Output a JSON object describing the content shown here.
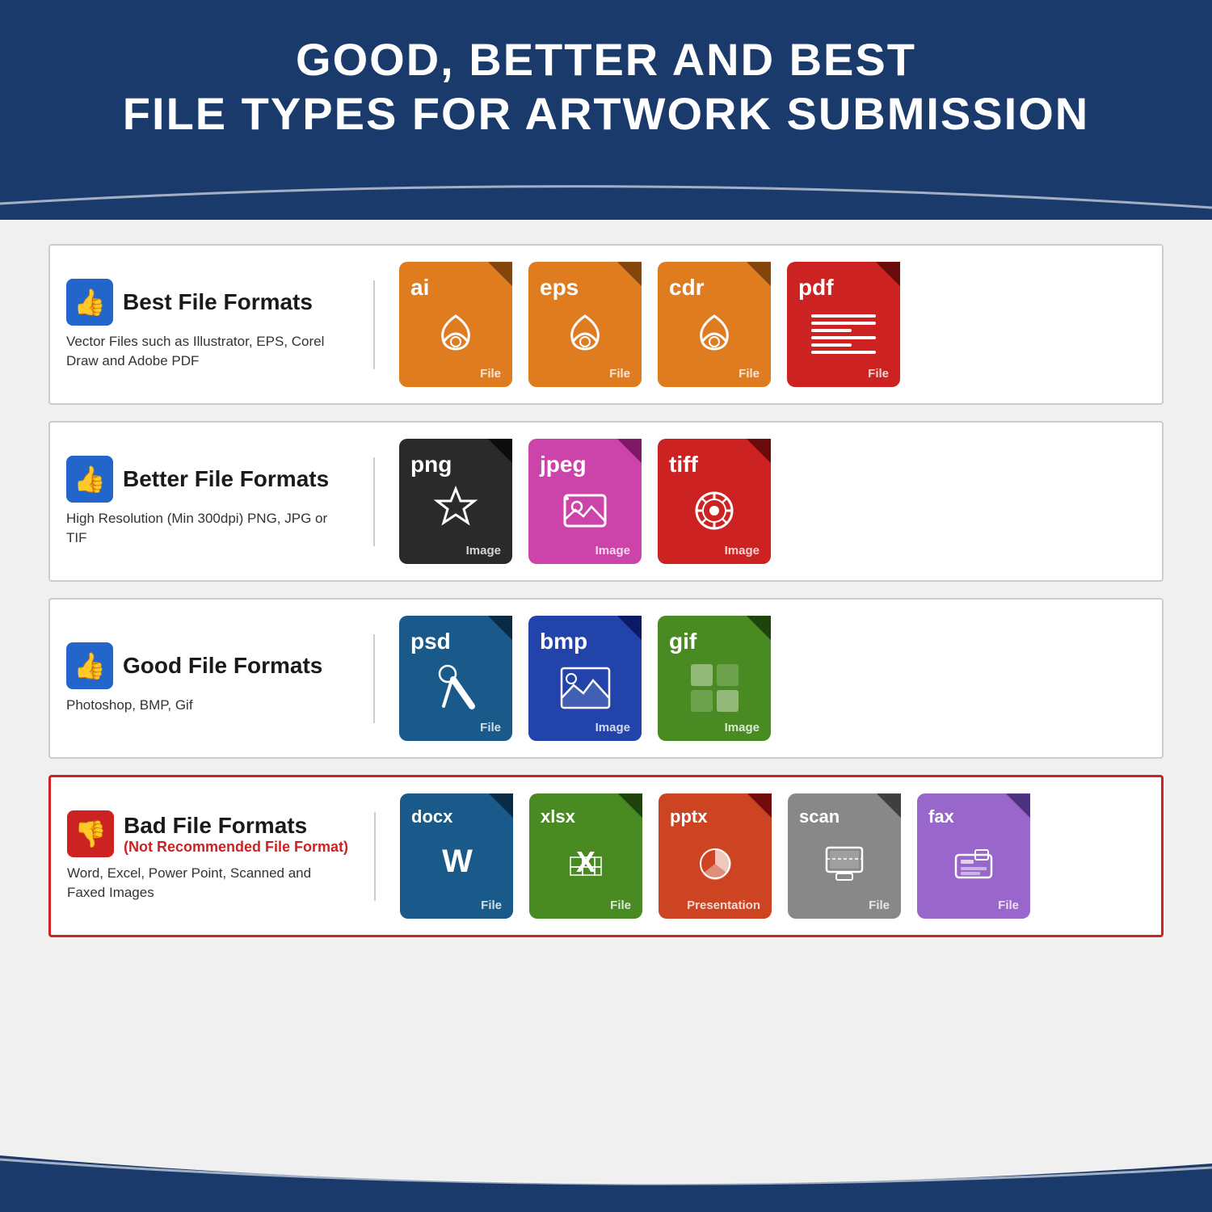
{
  "header": {
    "title_line1": "GOOD, BETTER AND BEST",
    "title_line2": "FILE TYPES FOR ARTWORK SUBMISSION"
  },
  "rows": [
    {
      "id": "best",
      "thumb_type": "up",
      "title": "Best File Formats",
      "subtitle": "",
      "description": "Vector Files such as Illustrator, EPS, Corel Draw and Adobe PDF",
      "files": [
        {
          "ext": "ai",
          "label": "File",
          "color": "ai-file",
          "graphic": "vector"
        },
        {
          "ext": "EPS",
          "label": "File",
          "color": "eps-file",
          "graphic": "vector"
        },
        {
          "ext": "cdr",
          "label": "File",
          "color": "cdr-file",
          "graphic": "vector"
        },
        {
          "ext": "Pdf",
          "label": "File",
          "color": "pdf-file",
          "graphic": "document"
        }
      ]
    },
    {
      "id": "better",
      "thumb_type": "up",
      "title": "Better File Formats",
      "subtitle": "",
      "description": "High Resolution (Min 300dpi) PNG, JPG or TIF",
      "files": [
        {
          "ext": "png",
          "label": "Image",
          "color": "png-file",
          "graphic": "snowflake"
        },
        {
          "ext": "Jpeg",
          "label": "Image",
          "color": "jpeg-file",
          "graphic": "camera"
        },
        {
          "ext": "tiff",
          "label": "Image",
          "color": "tiff-file",
          "graphic": "gear"
        }
      ]
    },
    {
      "id": "good",
      "thumb_type": "up",
      "title": "Good File Formats",
      "subtitle": "",
      "description": "Photoshop, BMP, Gif",
      "files": [
        {
          "ext": "Psd",
          "label": "File",
          "color": "psd-file",
          "graphic": "paint"
        },
        {
          "ext": "Bmp",
          "label": "Image",
          "color": "bmp-file",
          "graphic": "mountain"
        },
        {
          "ext": "Gif",
          "label": "Image",
          "color": "gif-file",
          "graphic": "grid"
        }
      ]
    },
    {
      "id": "bad",
      "thumb_type": "down",
      "title": "Bad File Formats",
      "subtitle": "(Not Recommended File Format)",
      "description": "Word, Excel, Power Point, Scanned and Faxed Images",
      "files": [
        {
          "ext": "docx",
          "label": "File",
          "color": "docx-file",
          "graphic": "word"
        },
        {
          "ext": "xlsx",
          "label": "File",
          "color": "xlsx-file",
          "graphic": "excel"
        },
        {
          "ext": "pptx",
          "label": "Presentation",
          "color": "pptx-file",
          "graphic": "ppt"
        },
        {
          "ext": "scan",
          "label": "File",
          "color": "scan-file",
          "graphic": "scan"
        },
        {
          "ext": "fax",
          "label": "File",
          "color": "fax-file",
          "graphic": "fax"
        }
      ]
    }
  ],
  "colors": {
    "dark_blue": "#1a3a6b",
    "medium_blue": "#2266cc",
    "red": "#cc2222",
    "white": "#ffffff"
  }
}
